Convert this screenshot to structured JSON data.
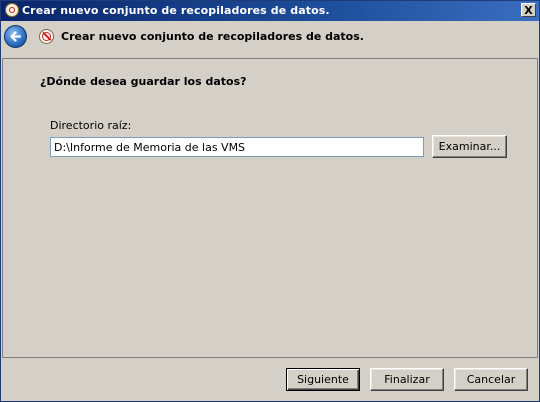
{
  "window": {
    "title": "Crear nuevo conjunto de recopiladores de datos.",
    "close_label": "X"
  },
  "header": {
    "title": "Crear nuevo conjunto de recopiladores de datos."
  },
  "main": {
    "question": "¿Dónde desea guardar los datos?",
    "root_dir_label": "Directorio raíz:",
    "root_dir_value": "D:\\Informe de Memoria de las VMS",
    "browse_label": "Examinar..."
  },
  "footer": {
    "next_label": "Siguiente",
    "finish_label": "Finalizar",
    "cancel_label": "Cancelar"
  },
  "icons": {
    "app": "performance-monitor-icon",
    "back": "back-arrow-icon",
    "wizard": "wizard-icon",
    "close": "close-icon"
  },
  "colors": {
    "title_bar": "#0a246a",
    "dialog_background": "#d4d0c8",
    "back_button": "#2a6bc0"
  }
}
